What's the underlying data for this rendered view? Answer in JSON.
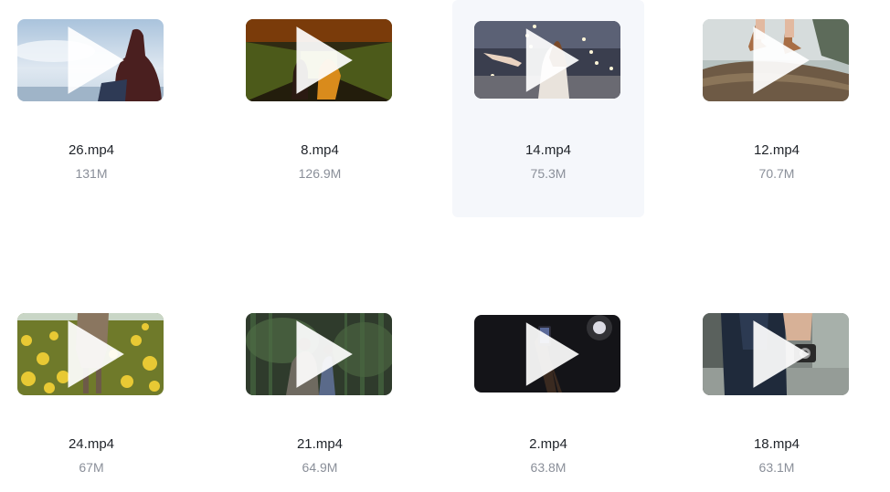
{
  "files": [
    {
      "name": "26.mp4",
      "size": "131M",
      "thumbnail": "woman-sitting-by-sea",
      "selected": false
    },
    {
      "name": "8.mp4",
      "size": "126.9M",
      "thumbnail": "people-walking-tunnel",
      "selected": false
    },
    {
      "name": "14.mp4",
      "size": "75.3M",
      "thumbnail": "woman-with-string-lights",
      "selected": true
    },
    {
      "name": "12.mp4",
      "size": "70.7M",
      "thumbnail": "boots-on-log",
      "selected": false
    },
    {
      "name": "24.mp4",
      "size": "67M",
      "thumbnail": "woman-in-flower-field",
      "selected": false
    },
    {
      "name": "21.mp4",
      "size": "64.9M",
      "thumbnail": "couple-in-forest",
      "selected": false
    },
    {
      "name": "2.mp4",
      "size": "63.8M",
      "thumbnail": "phone-photo-moon-night",
      "selected": false
    },
    {
      "name": "18.mp4",
      "size": "63.1M",
      "thumbnail": "person-holding-camera",
      "selected": false
    }
  ],
  "colors": {
    "selected_background": "#f5f7fb",
    "filename_text": "#1f2329",
    "size_text": "#8a8f99"
  }
}
